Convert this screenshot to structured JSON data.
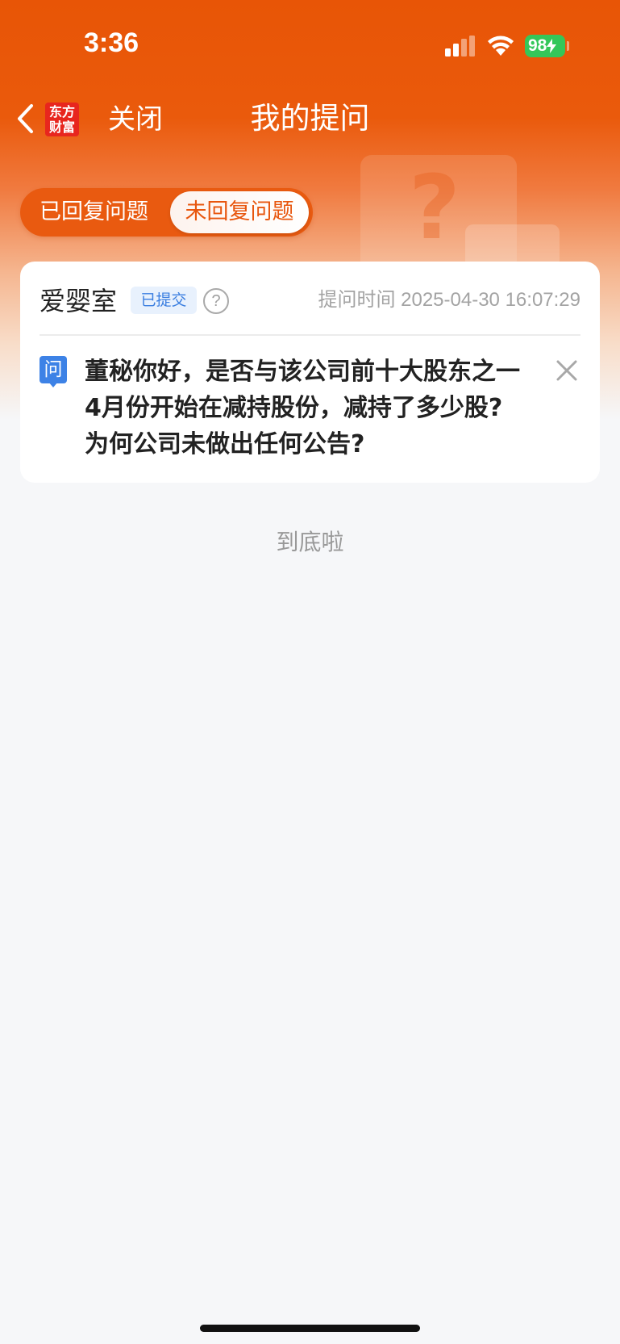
{
  "status_bar": {
    "time": "3:36",
    "battery": "98"
  },
  "nav": {
    "back_icon": "chevron-left-icon",
    "logo_line1": "东方",
    "logo_line2": "财富",
    "close_label": "关闭",
    "title": "我的提问"
  },
  "tabs": [
    {
      "label": "已回复问题",
      "selected": false
    },
    {
      "label": "未回复问题",
      "selected": true
    }
  ],
  "question_card": {
    "company": "爱婴室",
    "status": "已提交",
    "help_icon": "?",
    "time_label": "提问时间",
    "time_value": "2025-04-30 16:07:29",
    "q_icon_label": "问",
    "question_line1": "董秘你好，是否与该公司前十大股东之一",
    "question_line2": "4月份开始在减持股份，减持了多少股?",
    "question_line3": "为何公司未做出任何公告?"
  },
  "footer": {
    "end_text": "到底啦"
  },
  "colors": {
    "brand_orange": "#e85506",
    "accent_blue": "#3d82e6",
    "battery_green": "#34c759"
  }
}
